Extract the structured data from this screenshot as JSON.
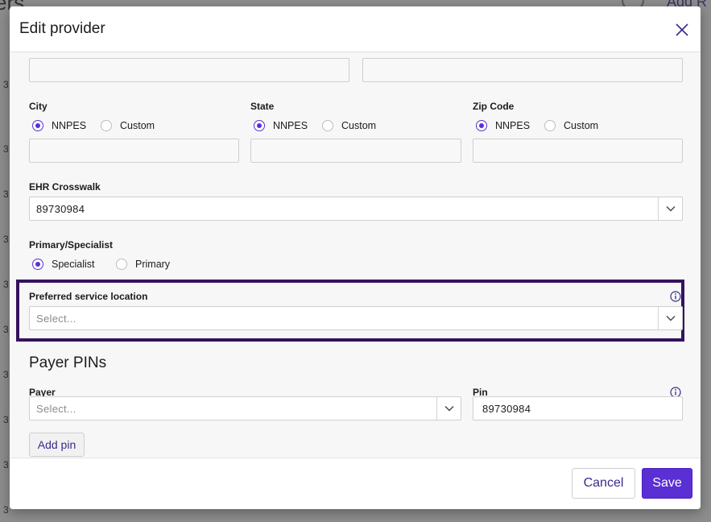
{
  "background": {
    "title_fragment": "ers",
    "add_button_fragment": "Add R",
    "row_digits": [
      "3",
      "3",
      "3",
      "3",
      "3",
      "3",
      "3",
      "3",
      "3",
      "3"
    ]
  },
  "modal": {
    "title": "Edit provider",
    "close_icon": "close-icon"
  },
  "address_fields": {
    "field_left_value": "",
    "field_right_value": ""
  },
  "city": {
    "label": "City",
    "options": [
      "NNPES",
      "Custom"
    ],
    "selected": "NNPES",
    "value": ""
  },
  "state": {
    "label": "State",
    "options": [
      "NNPES",
      "Custom"
    ],
    "selected": "NNPES",
    "value": ""
  },
  "zip": {
    "label": "Zip Code",
    "options": [
      "NNPES",
      "Custom"
    ],
    "selected": "NNPES",
    "value": ""
  },
  "ehr_crosswalk": {
    "label": "EHR Crosswalk",
    "value": "89730984"
  },
  "primary_specialist": {
    "label": "Primary/Specialist",
    "options": [
      "Specialist",
      "Primary"
    ],
    "selected": "Specialist"
  },
  "preferred_location": {
    "label": "Preferred service location",
    "placeholder": "Select...",
    "info_icon": "info-icon"
  },
  "payer_pins": {
    "title": "Payer PINs",
    "payer_label": "Payer",
    "payer_placeholder": "Select...",
    "pin_label": "Pin",
    "pin_value": "89730984",
    "add_pin_label": "Add pin"
  },
  "footer": {
    "cancel_label": "Cancel",
    "save_label": "Save"
  },
  "colors": {
    "accent": "#5a2fd3",
    "highlight_border": "#35125e"
  }
}
